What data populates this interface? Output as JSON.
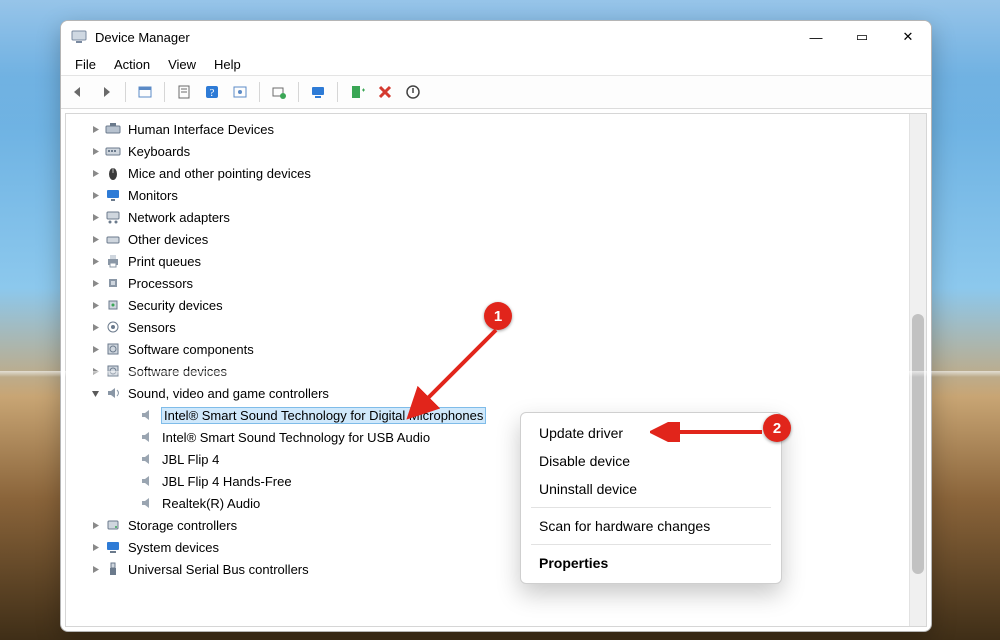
{
  "window": {
    "title": "Device Manager",
    "buttons": {
      "min": "—",
      "max": "▭",
      "close": "✕"
    }
  },
  "menubar": {
    "items": [
      "File",
      "Action",
      "View",
      "Help"
    ]
  },
  "toolbar_icons": [
    "nav-back-icon",
    "nav-forward-icon",
    "show-hidden-icon",
    "properties-icon",
    "help-icon",
    "refresh-icon",
    "update-driver-icon",
    "scan-hardware-icon",
    "add-legacy-icon",
    "uninstall-icon",
    "disable-icon"
  ],
  "tree": {
    "categories": [
      {
        "label": "Human Interface Devices",
        "icon": "hid-icon",
        "expanded": false
      },
      {
        "label": "Keyboards",
        "icon": "keyboard-icon",
        "expanded": false
      },
      {
        "label": "Mice and other pointing devices",
        "icon": "mouse-icon",
        "expanded": false
      },
      {
        "label": "Monitors",
        "icon": "monitor-icon",
        "expanded": false
      },
      {
        "label": "Network adapters",
        "icon": "network-icon",
        "expanded": false
      },
      {
        "label": "Other devices",
        "icon": "other-icon",
        "expanded": false
      },
      {
        "label": "Print queues",
        "icon": "printer-icon",
        "expanded": false
      },
      {
        "label": "Processors",
        "icon": "cpu-icon",
        "expanded": false
      },
      {
        "label": "Security devices",
        "icon": "security-icon",
        "expanded": false
      },
      {
        "label": "Sensors",
        "icon": "sensor-icon",
        "expanded": false
      },
      {
        "label": "Software components",
        "icon": "software-component-icon",
        "expanded": false
      },
      {
        "label": "Software devices",
        "icon": "software-device-icon",
        "expanded": false
      },
      {
        "label": "Sound, video and game controllers",
        "icon": "sound-icon",
        "expanded": true,
        "children": [
          {
            "label": "Intel® Smart Sound Technology for Digital Microphones",
            "icon": "speaker-icon",
            "selected": true
          },
          {
            "label": "Intel® Smart Sound Technology for USB Audio",
            "icon": "speaker-icon"
          },
          {
            "label": "JBL Flip 4",
            "icon": "speaker-icon"
          },
          {
            "label": "JBL Flip 4 Hands-Free",
            "icon": "speaker-icon"
          },
          {
            "label": "Realtek(R) Audio",
            "icon": "speaker-icon"
          }
        ]
      },
      {
        "label": "Storage controllers",
        "icon": "storage-icon",
        "expanded": false
      },
      {
        "label": "System devices",
        "icon": "system-icon",
        "expanded": false
      },
      {
        "label": "Universal Serial Bus controllers",
        "icon": "usb-icon",
        "expanded": false
      }
    ]
  },
  "context_menu": {
    "items": [
      {
        "label": "Update driver",
        "kind": "item"
      },
      {
        "label": "Disable device",
        "kind": "item"
      },
      {
        "label": "Uninstall device",
        "kind": "item"
      },
      {
        "kind": "sep"
      },
      {
        "label": "Scan for hardware changes",
        "kind": "item"
      },
      {
        "kind": "sep"
      },
      {
        "label": "Properties",
        "kind": "item",
        "bold": true
      }
    ]
  },
  "annotations": {
    "badge1": "1",
    "badge2": "2"
  }
}
